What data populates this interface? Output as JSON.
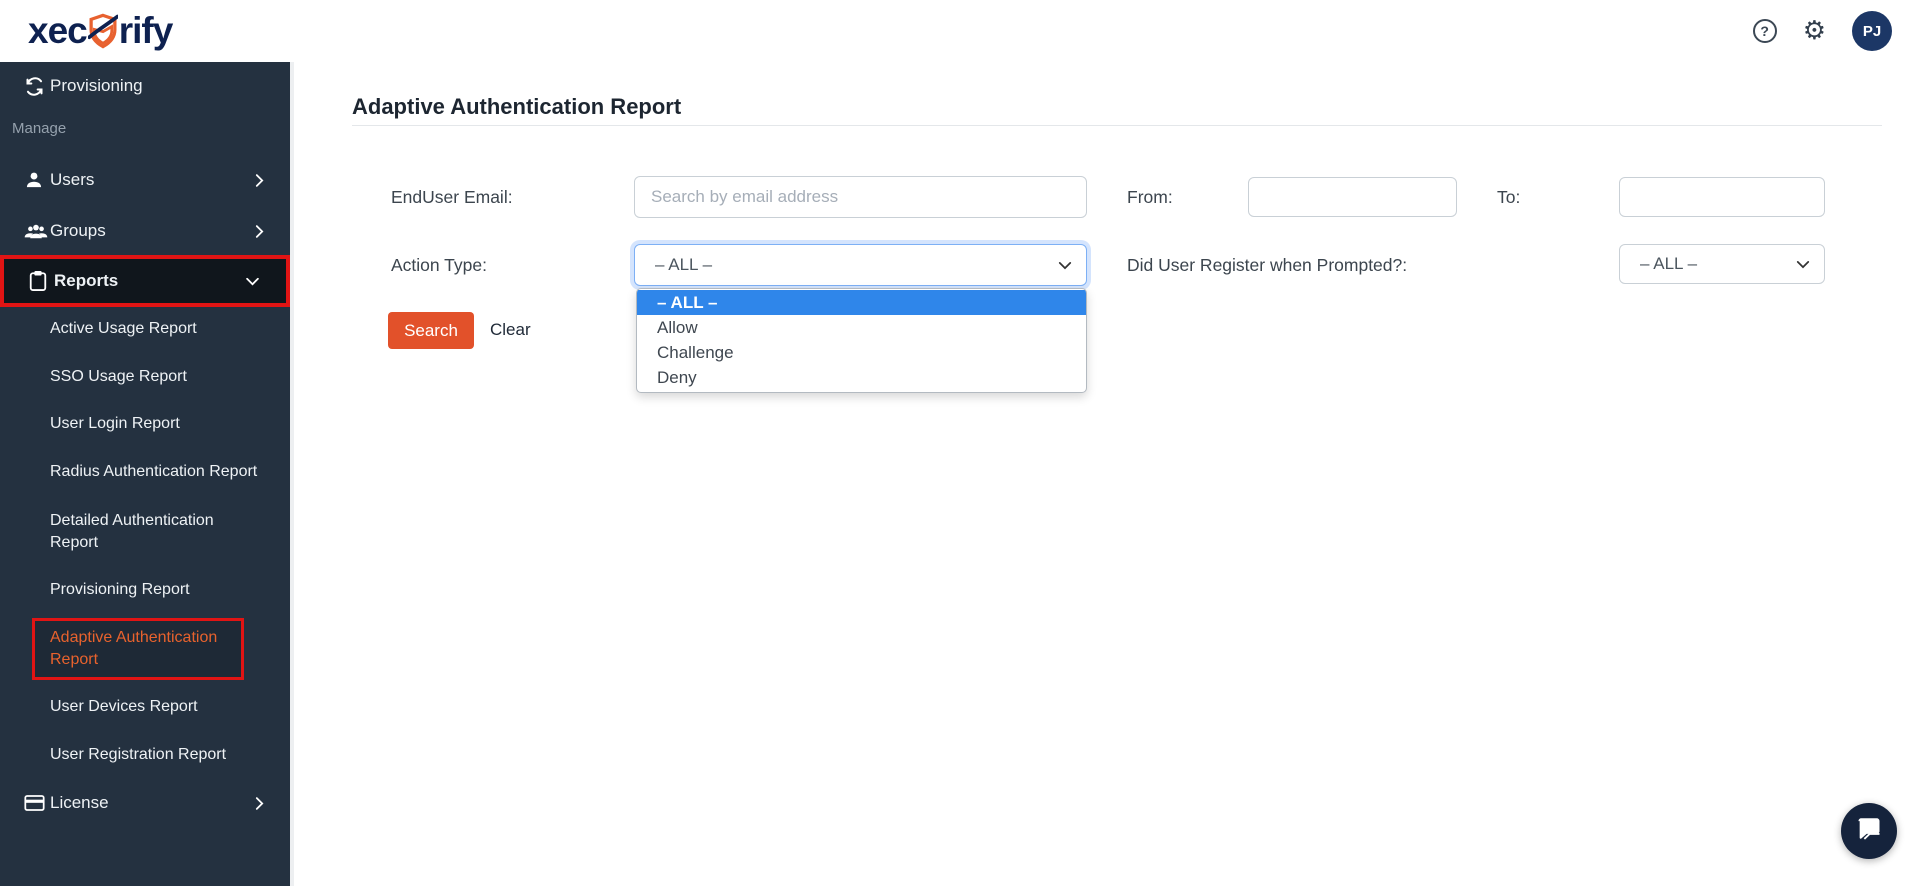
{
  "brand": {
    "logo_left": "xec",
    "logo_right": "rify"
  },
  "header": {
    "avatar_initials": "PJ",
    "help_glyph": "?",
    "gear_glyph": "⚙"
  },
  "sidebar": {
    "provisioning": "Provisioning",
    "section_manage": "Manage",
    "users": "Users",
    "groups": "Groups",
    "reports": "Reports",
    "submenu": [
      "Active Usage Report",
      "SSO Usage Report",
      "User Login Report",
      "Radius Authentication Report",
      "Detailed Authentication Report",
      "Provisioning Report",
      "Adaptive Authentication Report",
      "User Devices Report",
      "User Registration Report"
    ],
    "license": "License"
  },
  "main": {
    "title": "Adaptive Authentication Report",
    "form": {
      "enduser_email_label": "EndUser Email:",
      "enduser_email_placeholder": "Search by email address",
      "from_label": "From:",
      "to_label": "To:",
      "action_type_label": "Action Type:",
      "action_type_value": "– ALL –",
      "register_label": "Did User Register when Prompted?:",
      "register_value": "– ALL –",
      "search_button": "Search",
      "clear_button": "Clear"
    },
    "dropdown": {
      "options": [
        "– ALL –",
        "Allow",
        "Challenge",
        "Deny"
      ],
      "selected_index": 0
    }
  },
  "colors": {
    "sidebar_bg": "#243140",
    "brand_navy": "#0e2150",
    "brand_orange": "#e8612f",
    "highlight_red": "#e11414",
    "active_link_orange": "#e8622d",
    "search_button_orange": "#e2512a",
    "selected_option_blue": "#2f86ea",
    "avatar_bg": "#1c3766"
  }
}
